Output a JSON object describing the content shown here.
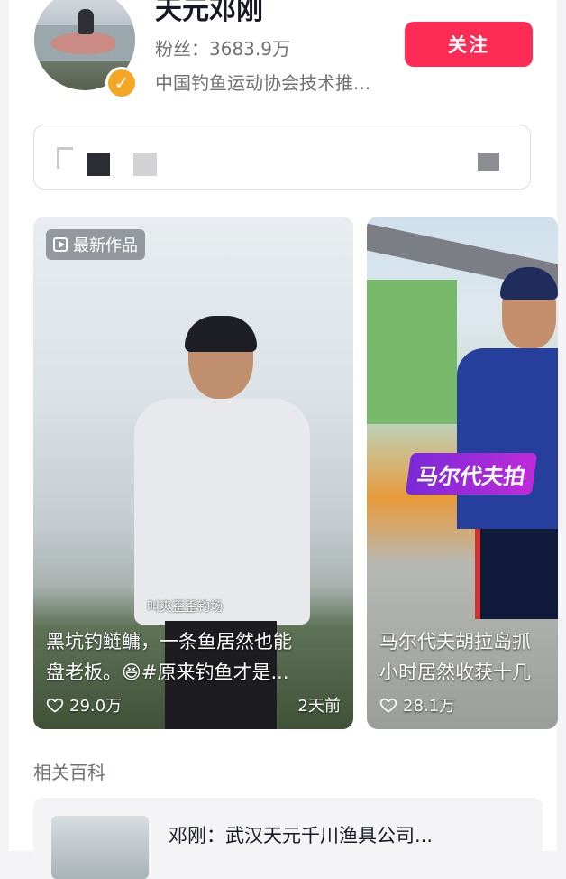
{
  "profile": {
    "name": "天元邓刚",
    "fans": "粉丝：3683.9万",
    "description": "中国钓鱼运动协会技术推...",
    "follow_label": "关注",
    "verified_icon": "✓"
  },
  "videos": [
    {
      "tag": "最新作品",
      "subtitle": "叫爽歪歪钓场",
      "caption_line1": "黑坑钓鲢鳙，一条鱼居然也能",
      "caption_line2": "盘老板。😆#原来钓鱼才是...",
      "likes": "29.0万",
      "time": "2天前"
    },
    {
      "banner": "马尔代夫拍",
      "caption_line1": "马尔代夫胡拉岛抓",
      "caption_line2": "小时居然收获十几",
      "likes": "28.1万"
    }
  ],
  "related": {
    "section_title": "相关百科",
    "item_title": "邓刚：武汉天元千川渔具公司..."
  },
  "colors": {
    "accent": "#fe2c55",
    "verified": "#f5a623"
  }
}
